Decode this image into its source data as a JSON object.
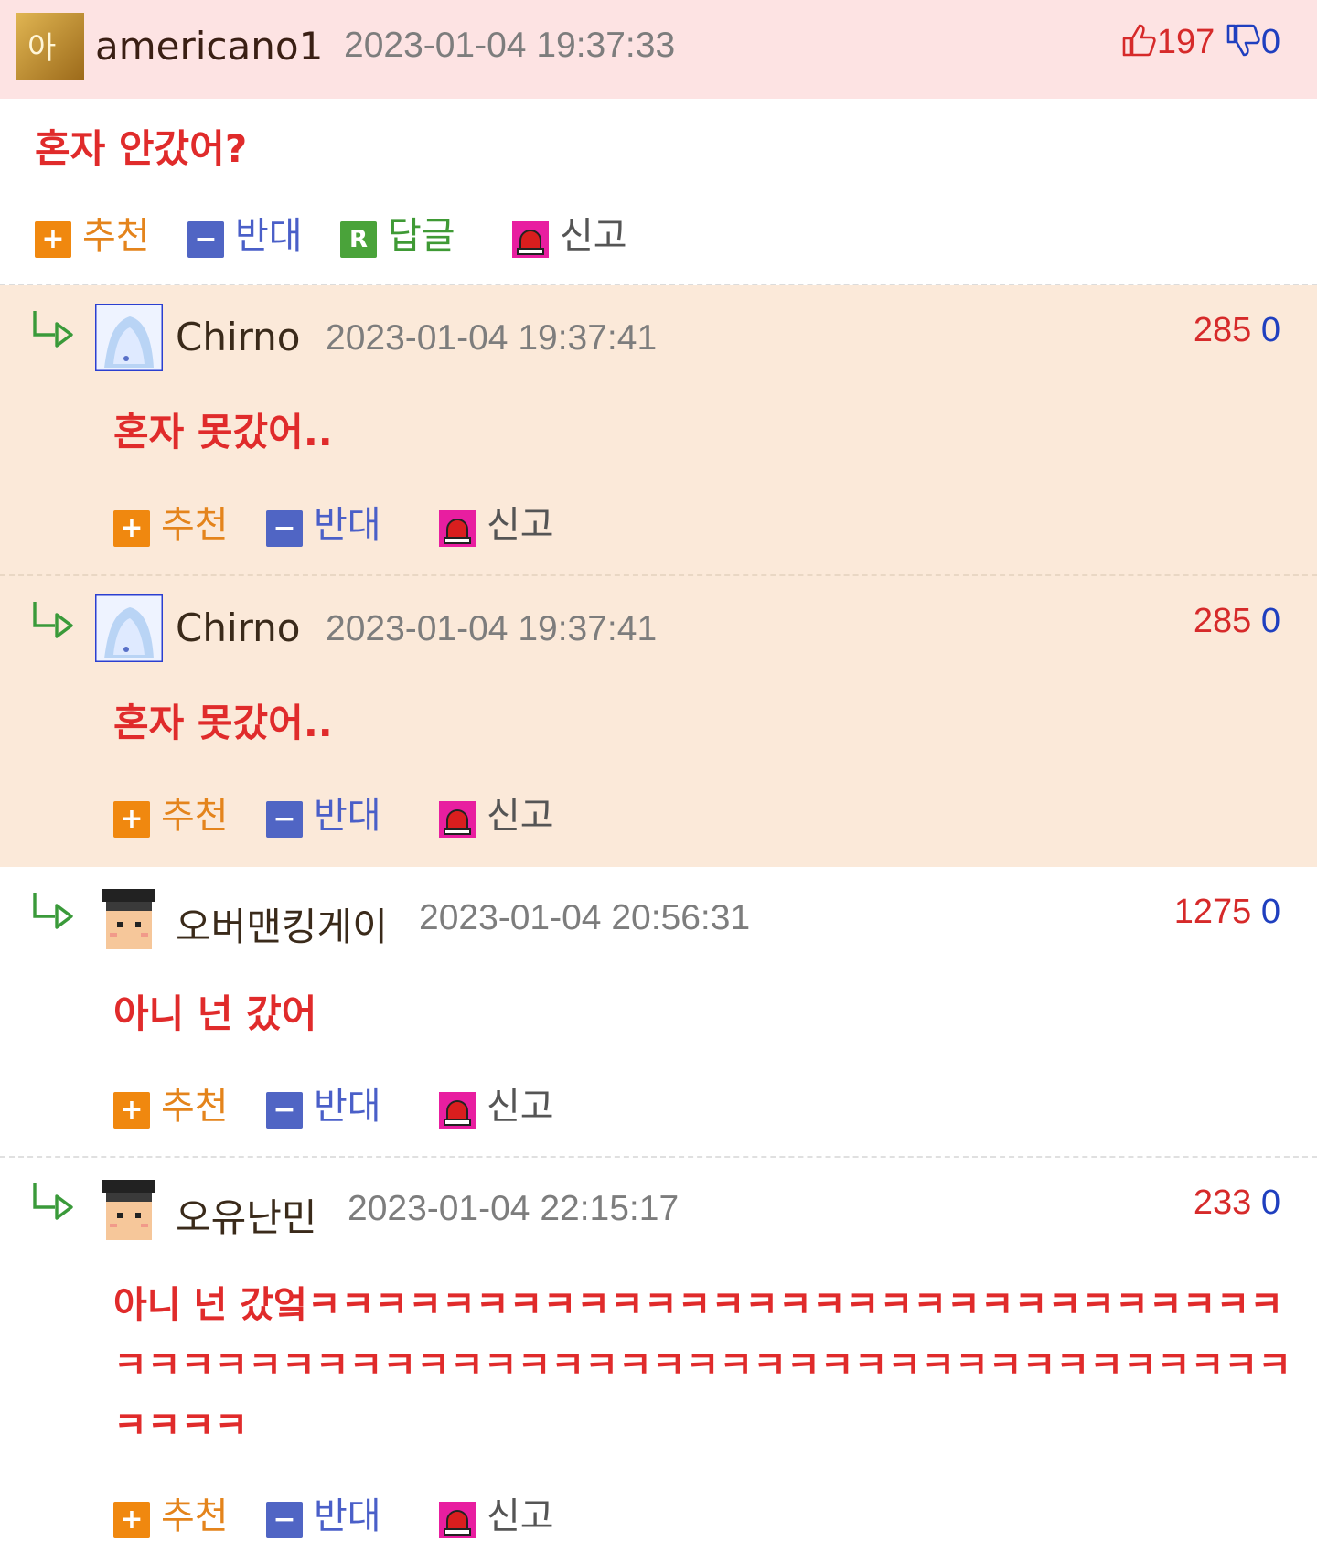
{
  "colors": {
    "up": "#d62a2a",
    "down": "#1f3fbf",
    "comment_text": "#e02b2b",
    "recommend": "#f0880f",
    "oppose": "#5065c4",
    "reply": "#4aa33a",
    "report": "#e81ea0"
  },
  "icons": {
    "recommend": "plus-icon",
    "oppose": "minus-icon",
    "reply": "reply-r-icon",
    "report": "siren-icon",
    "thread": "reply-arrow-icon",
    "up": "thumbs-up-icon",
    "down": "thumbs-down-icon"
  },
  "comments": [
    {
      "nick": "americano1",
      "date": "2023-01-04 19:37:33",
      "up": "197",
      "down": "0",
      "text": "혼자 안갔어?",
      "actions": {
        "recommend": "추천",
        "oppose": "반대",
        "reply": "답글",
        "report": "신고"
      }
    },
    {
      "nick": "Chirno",
      "date": "2023-01-04 19:37:41",
      "up": "285",
      "down": "0",
      "text": "혼자 못갔어..",
      "actions": {
        "recommend": "추천",
        "oppose": "반대",
        "report": "신고"
      }
    },
    {
      "nick": "Chirno",
      "date": "2023-01-04 19:37:41",
      "up": "285",
      "down": "0",
      "text": "혼자 못갔어..",
      "actions": {
        "recommend": "추천",
        "oppose": "반대",
        "report": "신고"
      }
    },
    {
      "nick": "오버맨킹게이",
      "date": "2023-01-04 20:56:31",
      "up": "1275",
      "down": "0",
      "text": "아니 넌 갔어",
      "actions": {
        "recommend": "추천",
        "oppose": "반대",
        "report": "신고"
      }
    },
    {
      "nick": "오유난민",
      "date": "2023-01-04 22:15:17",
      "up": "233",
      "down": "0",
      "text": "아니 넌 갔엌ㅋㅋㅋㅋㅋㅋㅋㅋㅋㅋㅋㅋㅋㅋㅋㅋㅋㅋㅋㅋㅋㅋㅋㅋㅋㅋㅋㅋㅋㅋㅋㅋㅋㅋㅋㅋㅋㅋㅋㅋㅋㅋㅋㅋㅋㅋㅋㅋㅋㅋㅋㅋㅋㅋㅋㅋㅋㅋㅋㅋㅋㅋㅋㅋㅋㅋㅋㅋ",
      "actions": {
        "recommend": "추천",
        "oppose": "반대",
        "report": "신고"
      }
    }
  ]
}
